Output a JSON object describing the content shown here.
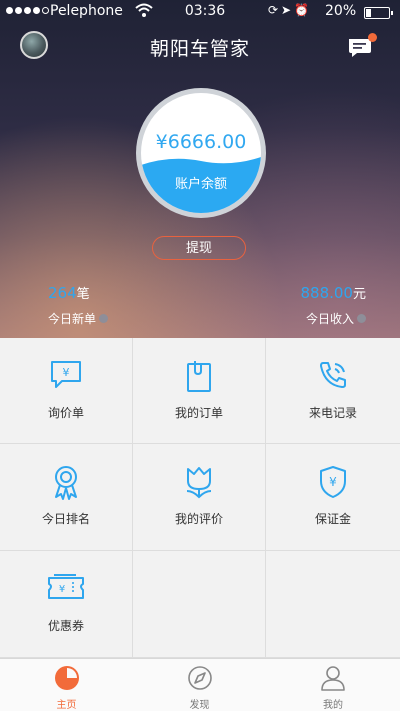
{
  "status_bar": {
    "carrier": "Pelephone",
    "time": "03:36",
    "battery": "20%"
  },
  "header": {
    "title": "朝阳车管家"
  },
  "account": {
    "balance": "¥6666.00",
    "balance_label": "账户余额",
    "withdraw_label": "提现",
    "fill_level": 0.45
  },
  "stats": {
    "new_orders": {
      "value": "264",
      "unit": "笔",
      "label": "今日新单"
    },
    "income": {
      "value": "888.00",
      "unit": "元",
      "label": "今日收入"
    }
  },
  "grid": {
    "items": [
      {
        "label": "询价单",
        "icon": "price-inquiry-icon"
      },
      {
        "label": "我的订单",
        "icon": "order-clip-icon"
      },
      {
        "label": "来电记录",
        "icon": "phone-call-icon"
      },
      {
        "label": "今日排名",
        "icon": "ranking-medal-icon"
      },
      {
        "label": "我的评价",
        "icon": "tulip-icon"
      },
      {
        "label": "保证金",
        "icon": "shield-yen-icon"
      },
      {
        "label": "优惠券",
        "icon": "coupon-icon"
      }
    ]
  },
  "tabs": [
    {
      "label": "主页",
      "icon": "home-pie-icon",
      "active": true
    },
    {
      "label": "发现",
      "icon": "compass-icon",
      "active": false
    },
    {
      "label": "我的",
      "icon": "user-icon",
      "active": false
    }
  ],
  "colors": {
    "accent_blue": "#2fa6ee",
    "accent_orange": "#f26b3a"
  }
}
